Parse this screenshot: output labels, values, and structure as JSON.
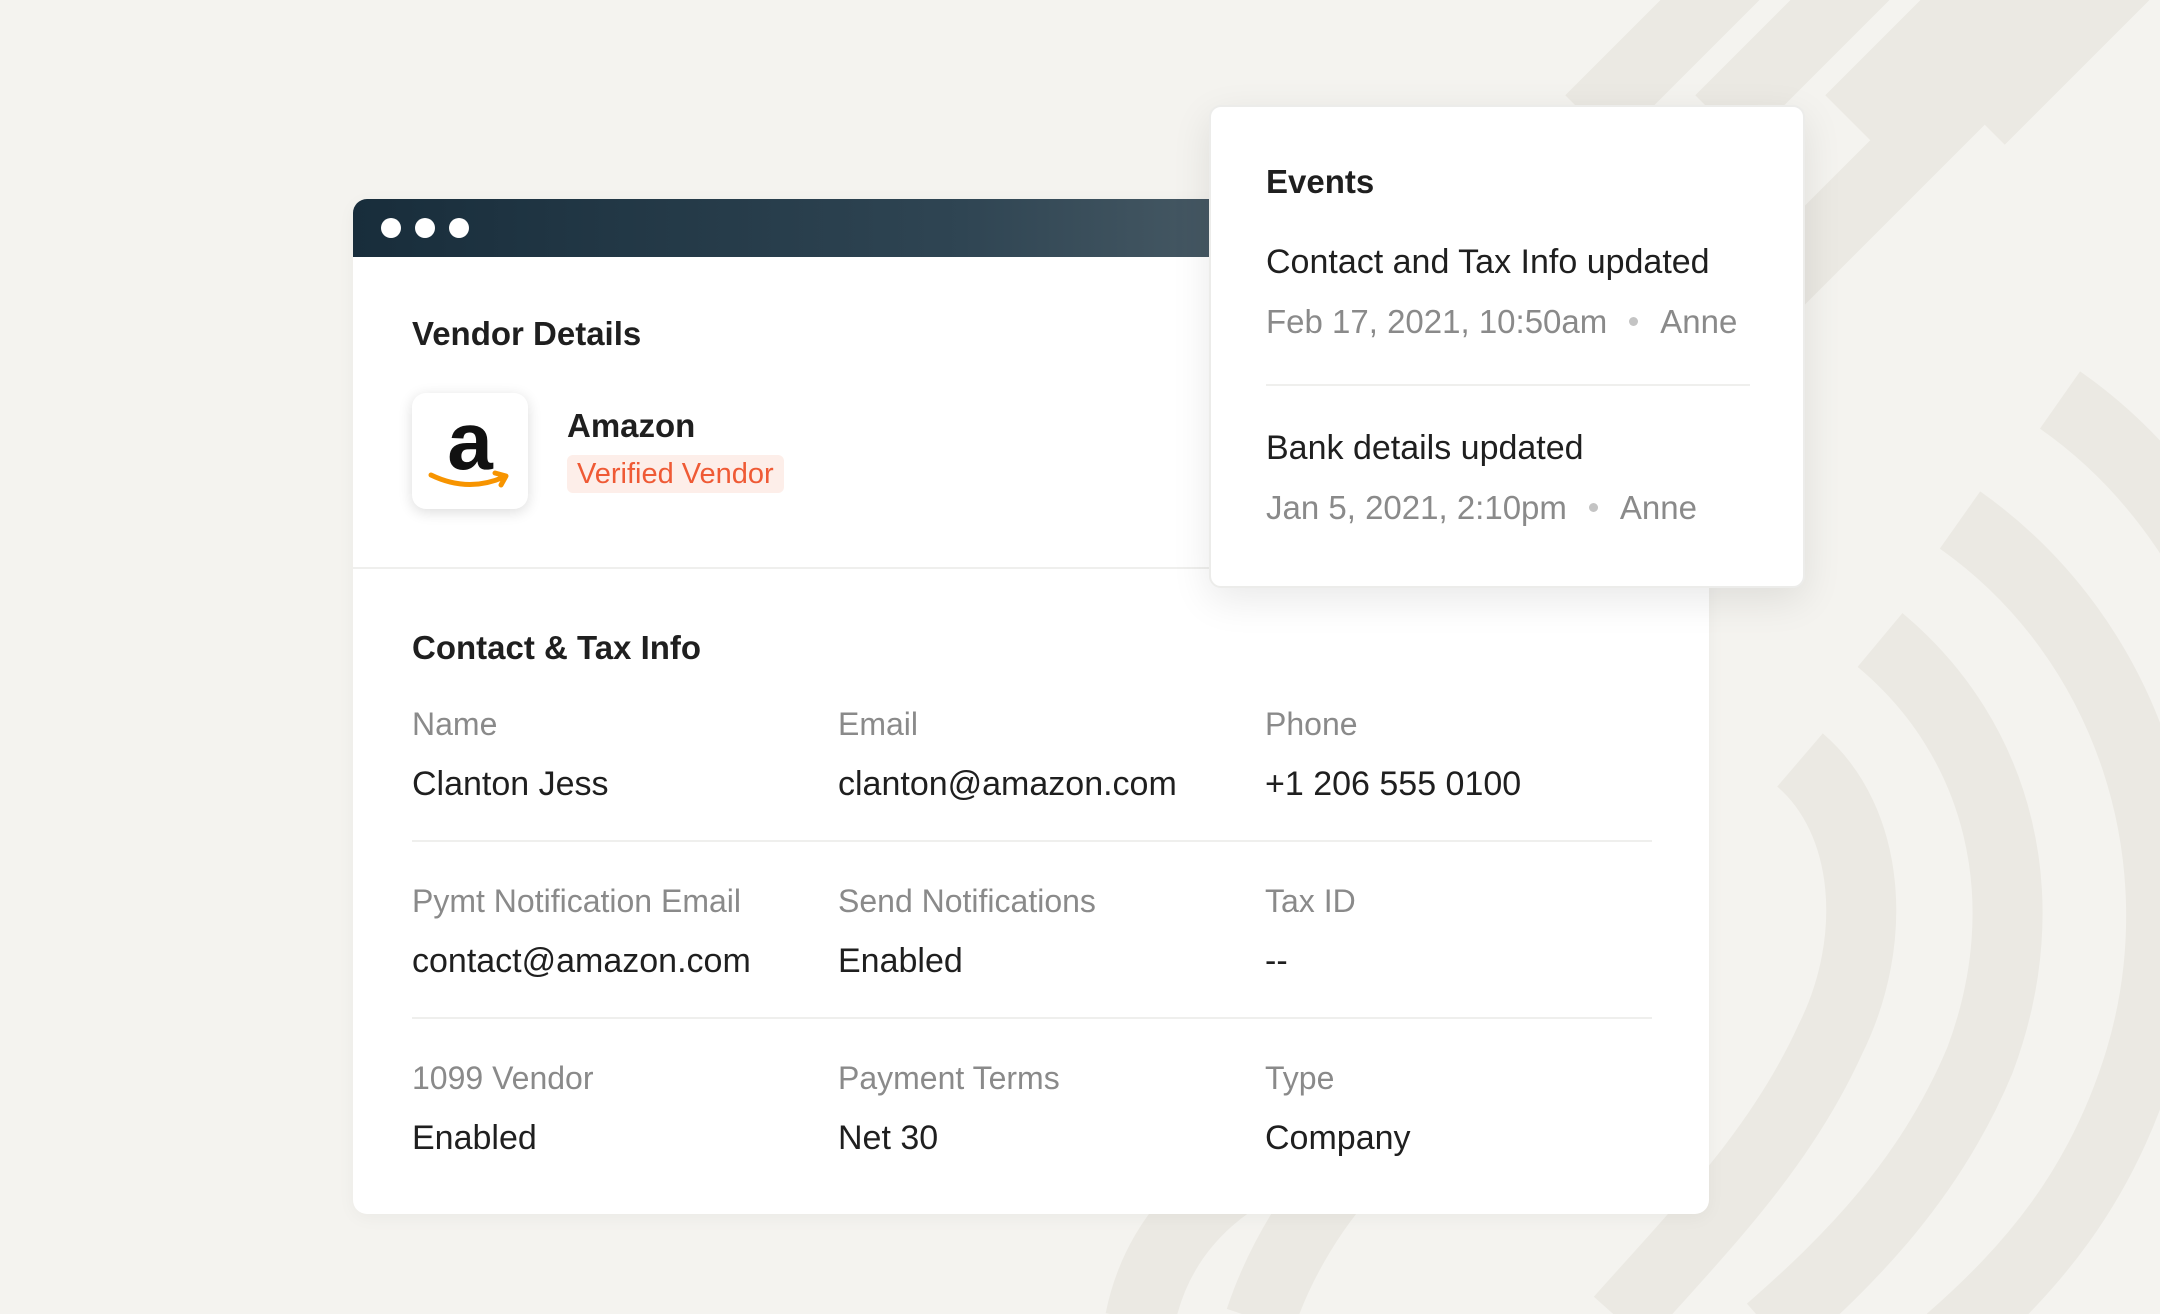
{
  "vendor_card": {
    "section_title": "Vendor Details",
    "vendor_name": "Amazon",
    "vendor_badge": "Verified Vendor",
    "logo_icon": "amazon-logo-icon"
  },
  "contact": {
    "section_title": "Contact & Tax Info",
    "fields": [
      {
        "label": "Name",
        "value": "Clanton Jess"
      },
      {
        "label": "Email",
        "value": "clanton@amazon.com"
      },
      {
        "label": "Phone",
        "value": "+1 206 555 0100"
      },
      {
        "label": "Pymt Notification Email",
        "value": "contact@amazon.com"
      },
      {
        "label": "Send Notifications",
        "value": "Enabled"
      },
      {
        "label": "Tax ID",
        "value": "--"
      },
      {
        "label": "1099 Vendor",
        "value": "Enabled"
      },
      {
        "label": "Payment Terms",
        "value": "Net 30"
      },
      {
        "label": "Type",
        "value": "Company"
      }
    ]
  },
  "events": {
    "title": "Events",
    "items": [
      {
        "title": "Contact and Tax Info updated",
        "date": "Feb 17, 2021, 10:50am",
        "user": "Anne"
      },
      {
        "title": "Bank details updated",
        "date": "Jan 5, 2021, 2:10pm",
        "user": "Anne"
      }
    ]
  },
  "colors": {
    "background": "#f4f3ef",
    "titlebar_dark": "#182d3b",
    "badge_text": "#ef5a35",
    "badge_bg": "#fdeee9",
    "amazon_orange": "#f79400"
  }
}
